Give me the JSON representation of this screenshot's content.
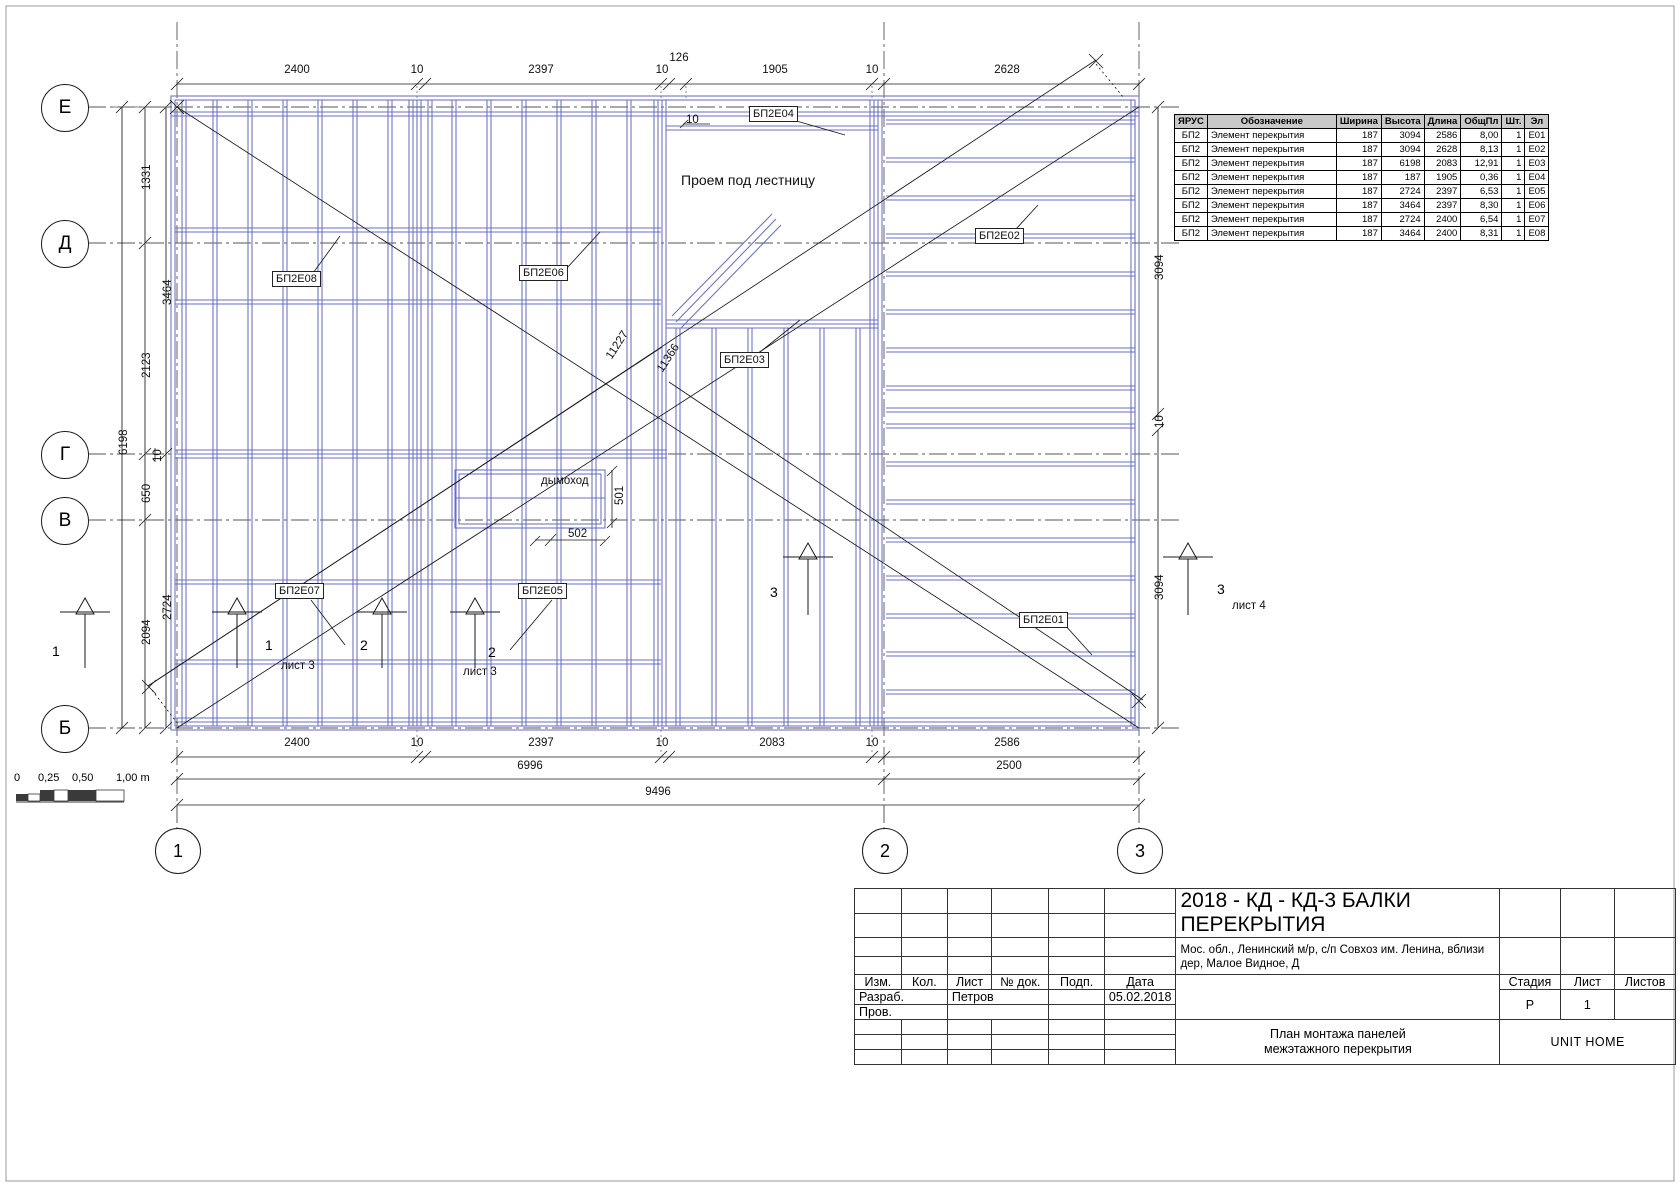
{
  "sheet": {
    "title": "2018 - КД - КД-3 БАЛКИ ПЕРЕКРЫТИЯ",
    "address": "Мос. обл., Ленинский м/р, с/п Совхоз им. Ленина, вблизи дер, Малое Видное, Д",
    "drawing_name_line1": "План монтажа панелей",
    "drawing_name_line2": "межэтажного перекрытия",
    "company": "UNIT HOME",
    "stage_header": "Стадия",
    "sheet_header": "Лист",
    "sheets_header": "Листов",
    "stage_value": "Р",
    "sheet_value": "1",
    "sheets_value": "",
    "rev_headers": [
      "Изм.",
      "Кол.",
      "Лист",
      "№ док.",
      "Подп.",
      "Дата"
    ],
    "role_rows": [
      {
        "role": "Разраб.",
        "name": "Петров",
        "sign": "",
        "date": "05.02.2018"
      },
      {
        "role": "Пров.",
        "name": "",
        "sign": "",
        "date": ""
      }
    ]
  },
  "spec_table": {
    "headers": [
      "ЯРУС",
      "Обозначение",
      "Ширина",
      "Высота",
      "Длина",
      "ОбщПл",
      "Шт.",
      "Эл"
    ],
    "rows": [
      [
        "БП2",
        "Элемент перекрытия",
        "187",
        "3094",
        "2586",
        "8,00",
        "1",
        "E01"
      ],
      [
        "БП2",
        "Элемент перекрытия",
        "187",
        "3094",
        "2628",
        "8,13",
        "1",
        "E02"
      ],
      [
        "БП2",
        "Элемент перекрытия",
        "187",
        "6198",
        "2083",
        "12,91",
        "1",
        "E03"
      ],
      [
        "БП2",
        "Элемент перекрытия",
        "187",
        "187",
        "1905",
        "0,36",
        "1",
        "E04"
      ],
      [
        "БП2",
        "Элемент перекрытия",
        "187",
        "2724",
        "2397",
        "6,53",
        "1",
        "E05"
      ],
      [
        "БП2",
        "Элемент перекрытия",
        "187",
        "3464",
        "2397",
        "8,30",
        "1",
        "E06"
      ],
      [
        "БП2",
        "Элемент перекрытия",
        "187",
        "2724",
        "2400",
        "6,54",
        "1",
        "E07"
      ],
      [
        "БП2",
        "Элемент перекрытия",
        "187",
        "3464",
        "2400",
        "8,31",
        "1",
        "E08"
      ]
    ]
  },
  "grid": {
    "horizontal_labels": [
      "Е",
      "Д",
      "Г",
      "В",
      "Б"
    ],
    "vertical_labels": [
      "1",
      "2",
      "3"
    ]
  },
  "dimensions": {
    "top": [
      "2400",
      "10",
      "2397",
      "10",
      "126",
      "1905",
      "10",
      "2628"
    ],
    "bottom_chain": [
      "2400",
      "10",
      "2397",
      "10",
      "2083",
      "10",
      "2586"
    ],
    "bottom_totals": [
      "6996",
      "2500"
    ],
    "overall": "9496",
    "left_outer": "6198",
    "left_chain": [
      "1331",
      "3464",
      "2123",
      "650",
      "2724",
      "2094"
    ],
    "left_small": "10",
    "right_upper": "3094",
    "right_small": "10",
    "right_lower": "3094",
    "inner_top_small": "10",
    "chimney_v": "501",
    "chimney_h": "502",
    "diag1": "11227",
    "diag2": "11366"
  },
  "labels": {
    "stair_opening": "Проем под лестницу",
    "chimney": "дымоход",
    "panels": [
      "БП2Е01",
      "БП2Е02",
      "БП2Е03",
      "БП2Е04",
      "БП2Е05",
      "БП2Е06",
      "БП2Е07",
      "БП2Е08"
    ]
  },
  "section_marks": [
    {
      "num": "1",
      "sheet": ""
    },
    {
      "num": "1",
      "sheet": ""
    },
    {
      "num": "2",
      "sheet": "лист 3"
    },
    {
      "num": "2",
      "sheet": ""
    },
    {
      "num": "2",
      "sheet": "лист 3"
    },
    {
      "num": "3",
      "sheet": ""
    },
    {
      "num": "3",
      "sheet": "лист 4"
    }
  ],
  "scale_bar": {
    "ticks": [
      "0",
      "0,25",
      "0,50",
      "1,00 m"
    ]
  },
  "colors": {
    "panel_line": "#6b6fc0",
    "draw_line": "#1a1a1a",
    "header_fill": "#c9c9c9"
  }
}
